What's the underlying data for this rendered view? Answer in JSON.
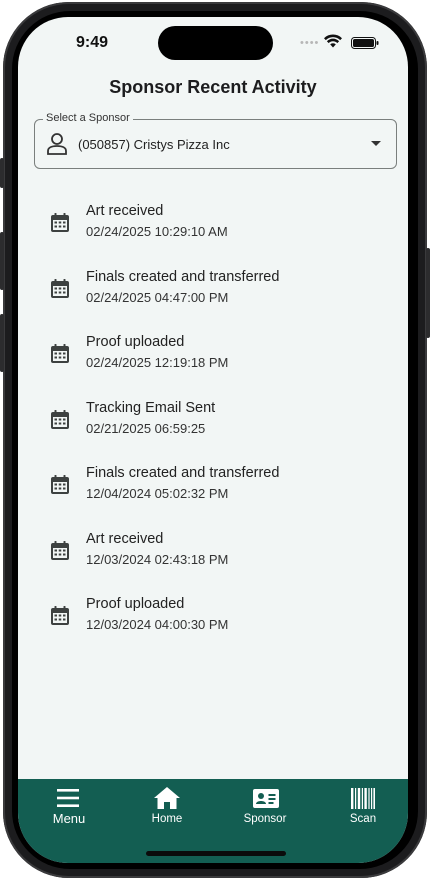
{
  "status_bar": {
    "time": "9:49",
    "signal_dots": "••••"
  },
  "header": {
    "title": "Sponsor Recent Activity"
  },
  "sponsor_select": {
    "label": "Select a Sponsor",
    "value": "(050857) Cristys Pizza Inc",
    "icon": "person-icon"
  },
  "activities": [
    {
      "title": "Art received",
      "date": "02/24/2025 10:29:10 AM"
    },
    {
      "title": "Finals created and transferred",
      "date": "02/24/2025 04:47:00 PM"
    },
    {
      "title": "Proof uploaded",
      "date": "02/24/2025 12:19:18 PM"
    },
    {
      "title": "Tracking Email Sent",
      "date": "02/21/2025 06:59:25"
    },
    {
      "title": "Finals created and transferred",
      "date": "12/04/2024 05:02:32 PM"
    },
    {
      "title": "Art received",
      "date": "12/03/2024 02:43:18 PM"
    },
    {
      "title": "Proof uploaded",
      "date": "12/03/2024 04:00:30 PM"
    }
  ],
  "bottom_nav": [
    {
      "label": "Menu",
      "icon": "hamburger-icon"
    },
    {
      "label": "Home",
      "icon": "home-icon"
    },
    {
      "label": "Sponsor",
      "icon": "id-card-icon"
    },
    {
      "label": "Scan",
      "icon": "barcode-icon"
    }
  ],
  "colors": {
    "nav_background": "#135e52",
    "screen_background": "#f2f6f5"
  }
}
